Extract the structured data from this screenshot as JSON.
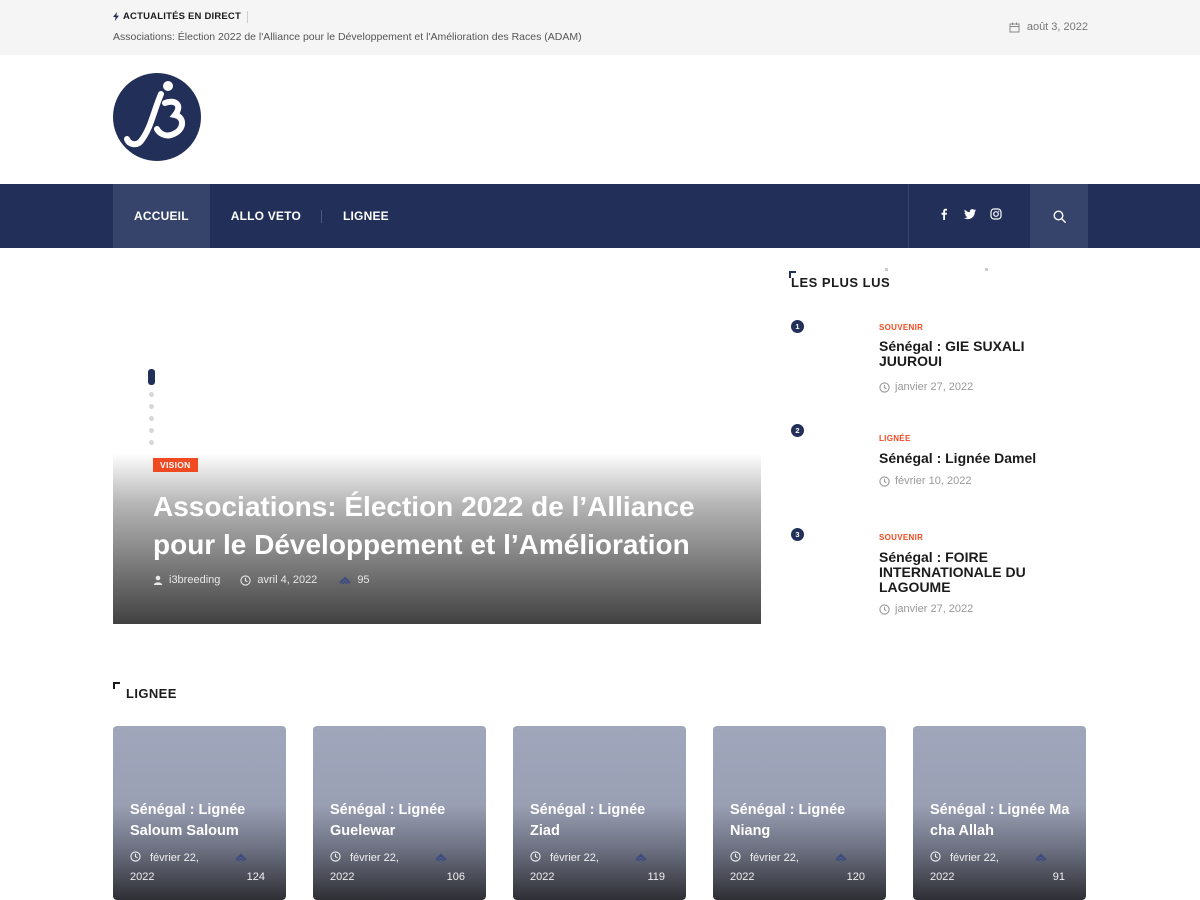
{
  "topbar": {
    "live_label": "ACTUALITÉS EN DIRECT",
    "ticker": "Associations: Élection 2022 de l'Alliance pour le Développement et l'Amélioration des Races (ADAM)",
    "date": "août 3, 2022"
  },
  "nav": {
    "items": [
      {
        "label": "ACCUEIL",
        "active": true
      },
      {
        "label": "ALLO VETO",
        "active": false
      },
      {
        "label": "LIGNEE",
        "active": false
      }
    ],
    "social": [
      "facebook-icon",
      "twitter-icon",
      "instagram-icon"
    ]
  },
  "hero": {
    "category": "VISION",
    "title": "Associations: Élection 2022 de l’Alliance pour le Développement et l’Amélioration",
    "author": "i3breeding",
    "date": "avril 4, 2022",
    "views": "95",
    "slider_dots": 6,
    "active_dot": 0
  },
  "sidebar": {
    "title": "LES PLUS LUS",
    "items": [
      {
        "num": "1",
        "category": "SOUVENIR",
        "title": "Sénégal : GIE SUXALI JUUROUI",
        "date": "janvier 27, 2022"
      },
      {
        "num": "2",
        "category": "LIGNÉE",
        "title": "Sénégal : Lignée Damel",
        "date": "février 10, 2022"
      },
      {
        "num": "3",
        "category": "SOUVENIR",
        "title": "Sénégal : FOIRE INTERNATIONALE DU LAGOUME",
        "date": "janvier 27, 2022"
      }
    ]
  },
  "lignee": {
    "title": "LIGNEE",
    "cards": [
      {
        "title": "Sénégal : Lignée Saloum Saloum",
        "date_line1": "février 22,",
        "date_line2": "2022",
        "views": "124"
      },
      {
        "title": "Sénégal : Lignée Guelewar",
        "date_line1": "février 22,",
        "date_line2": "2022",
        "views": "106"
      },
      {
        "title": "Sénégal : Lignée Ziad",
        "date_line1": "février 22,",
        "date_line2": "2022",
        "views": "119"
      },
      {
        "title": "Sénégal : Lignée Niang",
        "date_line1": "février 22,",
        "date_line2": "2022",
        "views": "120"
      },
      {
        "title": "Sénégal : Lignée Ma cha Allah",
        "date_line1": "février 22,",
        "date_line2": "2022",
        "views": "91"
      }
    ]
  },
  "colors": {
    "brand_navy": "#223059",
    "nav_active": "#36436a",
    "accent_orange": "#f04a23"
  }
}
